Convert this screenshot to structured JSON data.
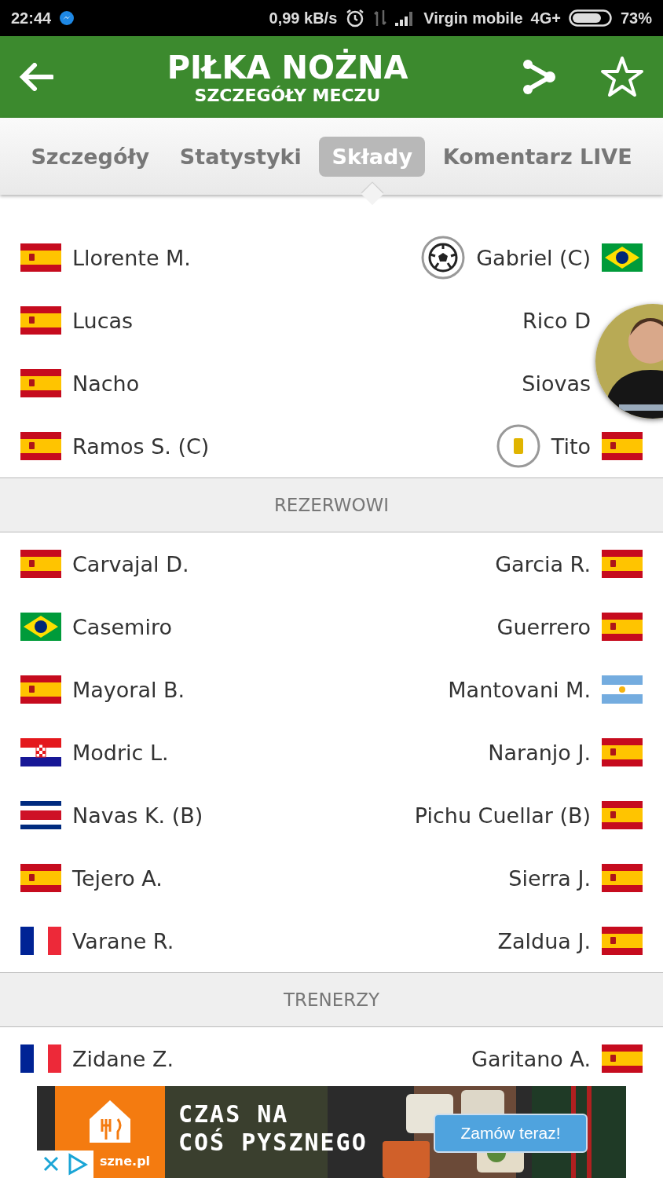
{
  "status_bar": {
    "time": "22:44",
    "speed": "0,99 kB/s",
    "carrier": "Virgin mobile",
    "network": "4G+",
    "battery": "73%"
  },
  "header": {
    "title": "PIŁKA NOŻNA",
    "subtitle": "SZCZEGÓŁY MECZU"
  },
  "tabs": [
    {
      "label": "Szczegóły",
      "selected": false
    },
    {
      "label": "Statystyki",
      "selected": false
    },
    {
      "label": "Składy",
      "selected": true
    },
    {
      "label": "Komentarz LIVE",
      "selected": false
    }
  ],
  "sections": [
    {
      "rows": [
        {
          "home": {
            "name": "Llorente M.",
            "flag": {
              "kind": "es"
            }
          },
          "away": {
            "name": "Gabriel (C)",
            "flag": {
              "kind": "br"
            },
            "event": {
              "kind": "goal"
            }
          }
        },
        {
          "home": {
            "name": "Lucas",
            "flag": {
              "kind": "es"
            }
          },
          "away": {
            "name": "Rico D"
          }
        },
        {
          "home": {
            "name": "Nacho",
            "flag": {
              "kind": "es"
            }
          },
          "away": {
            "name": "Siovas"
          }
        },
        {
          "home": {
            "name": "Ramos S. (C)",
            "flag": {
              "kind": "es"
            }
          },
          "away": {
            "name": "Tito",
            "flag": {
              "kind": "es"
            },
            "event": {
              "kind": "card"
            }
          }
        }
      ]
    },
    {
      "title": "REZERWOWI",
      "rows": [
        {
          "home": {
            "name": "Carvajal D.",
            "flag": {
              "kind": "es"
            }
          },
          "away": {
            "name": "Garcia R.",
            "flag": {
              "kind": "es"
            }
          }
        },
        {
          "home": {
            "name": "Casemiro",
            "flag": {
              "kind": "br"
            }
          },
          "away": {
            "name": "Guerrero",
            "flag": {
              "kind": "es"
            }
          }
        },
        {
          "home": {
            "name": "Mayoral B.",
            "flag": {
              "kind": "es"
            }
          },
          "away": {
            "name": "Mantovani M.",
            "flag": {
              "kind": "ar"
            }
          }
        },
        {
          "home": {
            "name": "Modric L.",
            "flag": {
              "kind": "hr"
            }
          },
          "away": {
            "name": "Naranjo J.",
            "flag": {
              "kind": "es"
            }
          }
        },
        {
          "home": {
            "name": "Navas K. (B)",
            "flag": {
              "kind": "cr"
            }
          },
          "away": {
            "name": "Pichu Cuellar (B)",
            "flag": {
              "kind": "es"
            }
          }
        },
        {
          "home": {
            "name": "Tejero A.",
            "flag": {
              "kind": "es"
            }
          },
          "away": {
            "name": "Sierra J.",
            "flag": {
              "kind": "es"
            }
          }
        },
        {
          "home": {
            "name": "Varane R.",
            "flag": {
              "kind": "fr"
            }
          },
          "away": {
            "name": "Zaldua J.",
            "flag": {
              "kind": "es"
            }
          }
        }
      ]
    },
    {
      "title": "TRENERZY",
      "rows": [
        {
          "home": {
            "name": "Zidane Z.",
            "flag": {
              "kind": "fr"
            }
          },
          "away": {
            "name": "Garitano A.",
            "flag": {
              "kind": "es"
            }
          }
        }
      ]
    }
  ],
  "ad": {
    "headline_1": "CZAS NA",
    "headline_2": "COŚ PYSZNEGO",
    "button": "Zamów teraz!",
    "brand": "szne.pl"
  }
}
